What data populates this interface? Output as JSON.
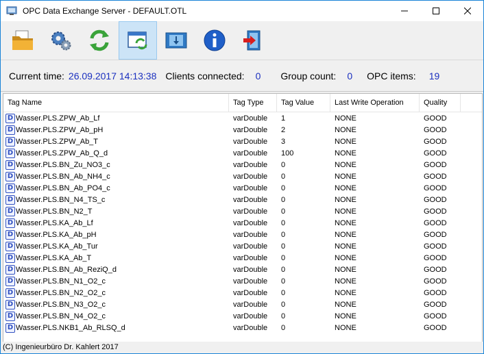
{
  "window": {
    "title": "OPC Data Exchange Server - DEFAULT.OTL"
  },
  "toolbar": {
    "buttons": [
      {
        "icon": "folder-open-icon"
      },
      {
        "icon": "gears-icon"
      },
      {
        "icon": "refresh-icon"
      },
      {
        "icon": "window-refresh-icon"
      },
      {
        "icon": "film-download-icon"
      },
      {
        "icon": "info-icon"
      },
      {
        "icon": "exit-door-icon"
      }
    ]
  },
  "status": {
    "current_time_label": "Current time:",
    "current_time_value": "26.09.2017 14:13:38",
    "clients_label": "Clients connected:",
    "clients_value": "0",
    "group_label": "Group count:",
    "group_value": "0",
    "items_label": "OPC items:",
    "items_value": "19"
  },
  "table": {
    "columns": [
      "Tag Name",
      "Tag Type",
      "Tag Value",
      "Last Write Operation",
      "Quality"
    ],
    "rows": [
      [
        "Wasser.PLS.ZPW_Ab_Lf",
        "varDouble",
        "1",
        "NONE",
        "GOOD"
      ],
      [
        "Wasser.PLS.ZPW_Ab_pH",
        "varDouble",
        "2",
        "NONE",
        "GOOD"
      ],
      [
        "Wasser.PLS.ZPW_Ab_T",
        "varDouble",
        "3",
        "NONE",
        "GOOD"
      ],
      [
        "Wasser.PLS.ZPW_Ab_Q_d",
        "varDouble",
        "100",
        "NONE",
        "GOOD"
      ],
      [
        "Wasser.PLS.BN_Zu_NO3_c",
        "varDouble",
        "0",
        "NONE",
        "GOOD"
      ],
      [
        "Wasser.PLS.BN_Ab_NH4_c",
        "varDouble",
        "0",
        "NONE",
        "GOOD"
      ],
      [
        "Wasser.PLS.BN_Ab_PO4_c",
        "varDouble",
        "0",
        "NONE",
        "GOOD"
      ],
      [
        "Wasser.PLS.BN_N4_TS_c",
        "varDouble",
        "0",
        "NONE",
        "GOOD"
      ],
      [
        "Wasser.PLS.BN_N2_T",
        "varDouble",
        "0",
        "NONE",
        "GOOD"
      ],
      [
        "Wasser.PLS.KA_Ab_Lf",
        "varDouble",
        "0",
        "NONE",
        "GOOD"
      ],
      [
        "Wasser.PLS.KA_Ab_pH",
        "varDouble",
        "0",
        "NONE",
        "GOOD"
      ],
      [
        "Wasser.PLS.KA_Ab_Tur",
        "varDouble",
        "0",
        "NONE",
        "GOOD"
      ],
      [
        "Wasser.PLS.KA_Ab_T",
        "varDouble",
        "0",
        "NONE",
        "GOOD"
      ],
      [
        "Wasser.PLS.BN_Ab_ReziQ_d",
        "varDouble",
        "0",
        "NONE",
        "GOOD"
      ],
      [
        "Wasser.PLS.BN_N1_O2_c",
        "varDouble",
        "0",
        "NONE",
        "GOOD"
      ],
      [
        "Wasser.PLS.BN_N2_O2_c",
        "varDouble",
        "0",
        "NONE",
        "GOOD"
      ],
      [
        "Wasser.PLS.BN_N3_O2_c",
        "varDouble",
        "0",
        "NONE",
        "GOOD"
      ],
      [
        "Wasser.PLS.BN_N4_O2_c",
        "varDouble",
        "0",
        "NONE",
        "GOOD"
      ],
      [
        "Wasser.PLS.NKB1_Ab_RLSQ_d",
        "varDouble",
        "0",
        "NONE",
        "GOOD"
      ]
    ],
    "row_type_icon_letter": "D"
  },
  "statusbar": {
    "text": "(C) Ingenieurbüro Dr. Kahlert 2017"
  },
  "colors": {
    "value_blue": "#1a2fbf",
    "window_border": "#1883d7",
    "active_button": "#cce4f7"
  }
}
